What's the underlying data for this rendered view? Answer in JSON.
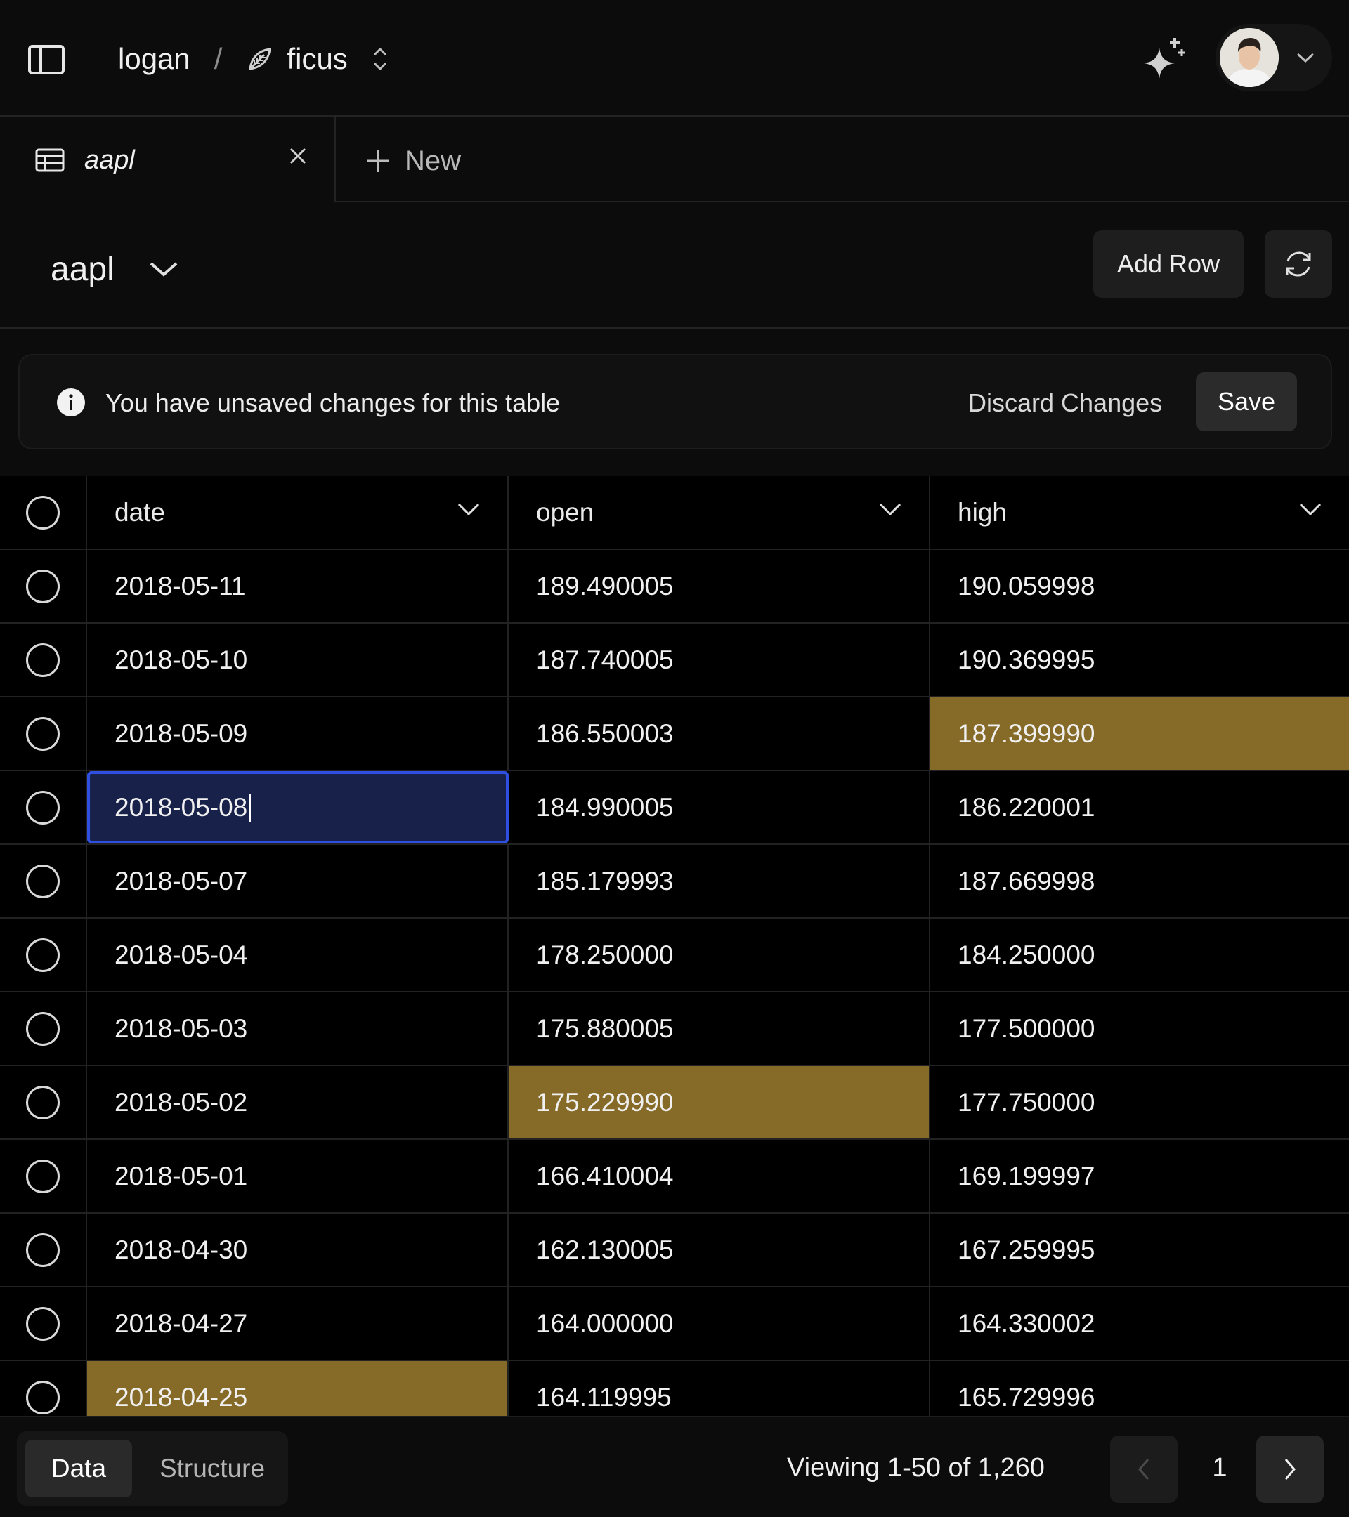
{
  "topbar": {
    "owner": "logan",
    "separator": "/",
    "project": "ficus"
  },
  "tabs": {
    "active_label": "aapl",
    "new_label": "New"
  },
  "table_header": {
    "selected_table": "aapl",
    "add_row_label": "Add Row"
  },
  "notice": {
    "message": "You have unsaved changes for this table",
    "discard_label": "Discard Changes",
    "save_label": "Save"
  },
  "grid": {
    "columns": [
      "date",
      "open",
      "high"
    ],
    "rows": [
      {
        "date": "2018-05-11",
        "open": "189.490005",
        "high": "190.059998"
      },
      {
        "date": "2018-05-10",
        "open": "187.740005",
        "high": "190.369995"
      },
      {
        "date": "2018-05-09",
        "open": "186.550003",
        "high": "187.399990"
      },
      {
        "date": "2018-05-08",
        "open": "184.990005",
        "high": "186.220001"
      },
      {
        "date": "2018-05-07",
        "open": "185.179993",
        "high": "187.669998"
      },
      {
        "date": "2018-05-04",
        "open": "178.250000",
        "high": "184.250000"
      },
      {
        "date": "2018-05-03",
        "open": "175.880005",
        "high": "177.500000"
      },
      {
        "date": "2018-05-02",
        "open": "175.229990",
        "high": "177.750000"
      },
      {
        "date": "2018-05-01",
        "open": "166.410004",
        "high": "169.199997"
      },
      {
        "date": "2018-04-30",
        "open": "162.130005",
        "high": "167.259995"
      },
      {
        "date": "2018-04-27",
        "open": "164.000000",
        "high": "164.330002"
      },
      {
        "date": "2018-04-25",
        "open": "164.119995",
        "high": "165.729996"
      }
    ],
    "modified_cells": [
      {
        "row": 2,
        "column": "high"
      },
      {
        "row": 7,
        "column": "open"
      },
      {
        "row": 11,
        "column": "date"
      }
    ],
    "editing_cell": {
      "row": 3,
      "column": "date"
    }
  },
  "footer": {
    "view_options": [
      "Data",
      "Structure"
    ],
    "active_view": "Data",
    "viewing_text": "Viewing 1-50 of 1,260",
    "current_page": "1"
  },
  "icons": {
    "sidebar": "sidebar-toggle-icon",
    "project": "leaf-icon",
    "switcher": "chevron-up-down-icon",
    "ai": "sparkle-icon",
    "table": "table-icon",
    "close": "close-icon",
    "add": "plus-icon",
    "refresh": "refresh-icon",
    "info": "info-icon",
    "prev": "chevron-left-icon",
    "next": "chevron-right-icon"
  },
  "colors": {
    "modified_cell": "#866a27",
    "editing_cell_bg": "#18214a",
    "editing_cell_border": "#2f4fe0",
    "background": "#000000",
    "panel": "#0c0c0c"
  }
}
